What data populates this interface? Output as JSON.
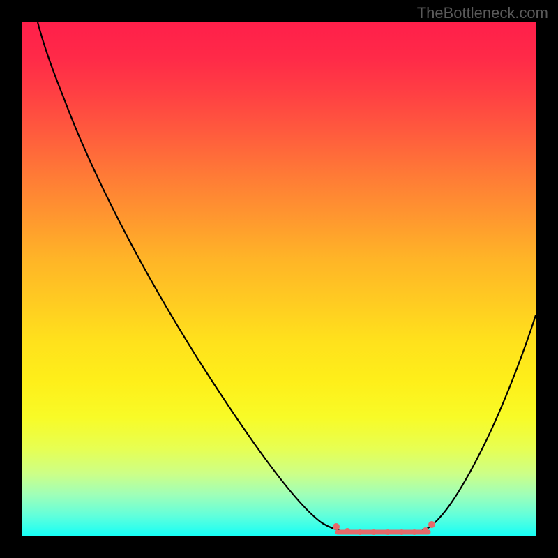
{
  "watermark": "TheBottleneck.com",
  "chart_data": {
    "type": "line",
    "title": "",
    "xlabel": "",
    "ylabel": "",
    "xlim": [
      0,
      100
    ],
    "ylim": [
      0,
      100
    ],
    "series": [
      {
        "name": "curve",
        "x": [
          3,
          6,
          10,
          15,
          20,
          26,
          32,
          38,
          44,
          50,
          55,
          58,
          61,
          64,
          70,
          77,
          80,
          83,
          87,
          91,
          95,
          100
        ],
        "y": [
          100,
          97,
          92,
          85,
          77,
          68,
          58,
          49,
          39,
          29,
          20,
          14,
          9,
          5,
          1,
          1,
          3,
          8,
          16,
          26,
          37,
          50
        ]
      }
    ],
    "highlight_range": {
      "x_start": 61,
      "x_end": 80,
      "y": 1,
      "dots_x": [
        61,
        63,
        65,
        68,
        71,
        74,
        77,
        79,
        80
      ]
    },
    "colors": {
      "curve": "#000000",
      "highlight": "#e56a6a",
      "gradient_top": "#ff1f4a",
      "gradient_bottom": "#17fff6"
    }
  }
}
